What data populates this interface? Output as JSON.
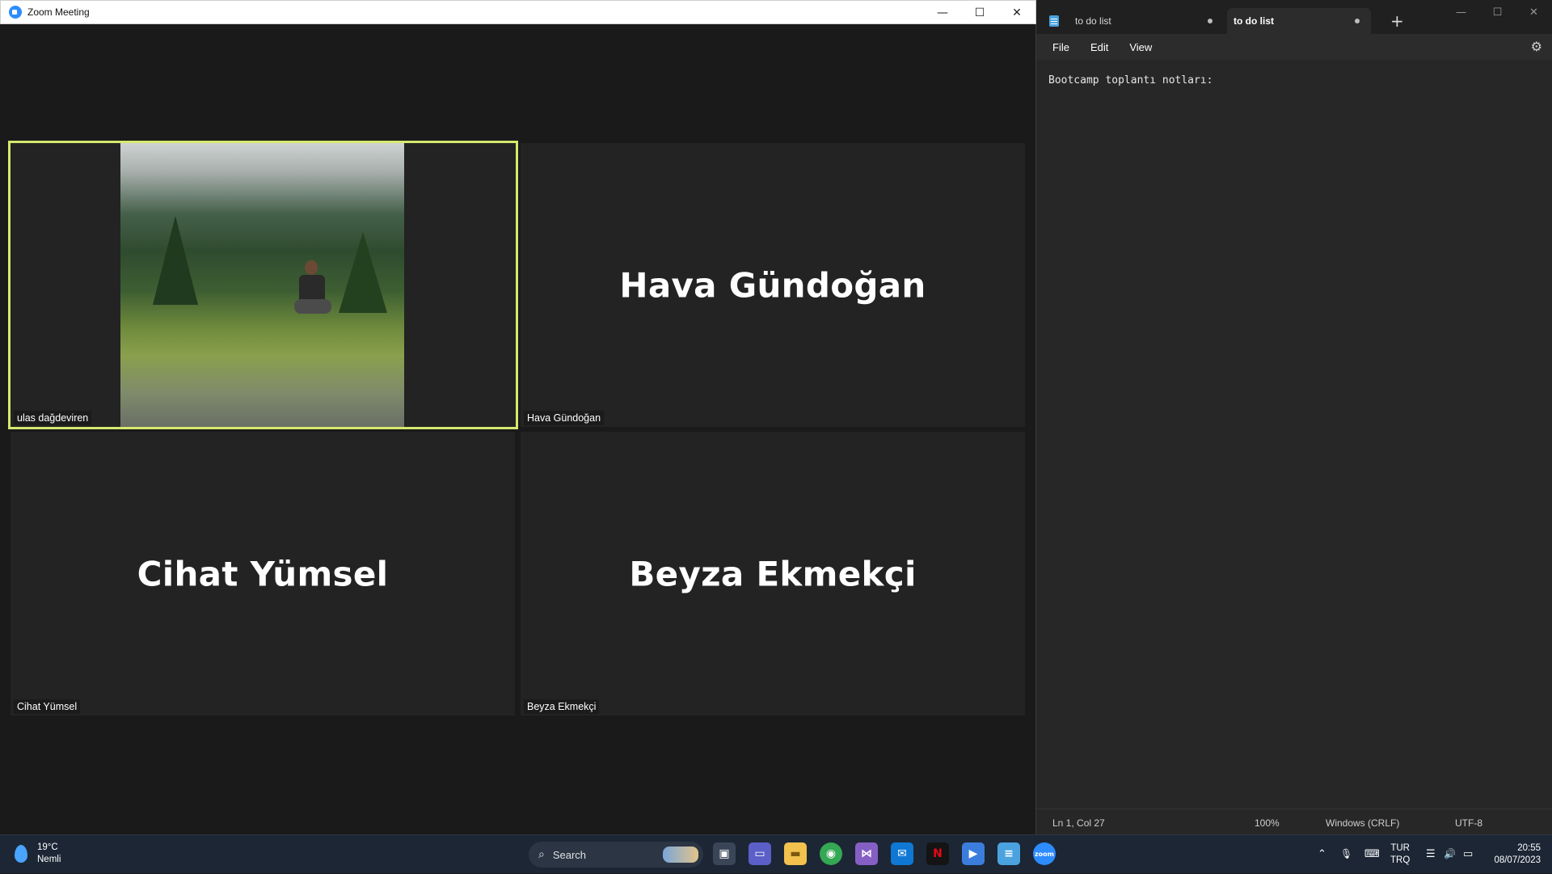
{
  "zoom": {
    "title": "Zoom Meeting",
    "controls": {
      "minimize": "—",
      "maximize": "☐",
      "close": "✕"
    },
    "participants": [
      {
        "display_name": "",
        "name_tag": "ulas dağdeviren",
        "active_speaker": true
      },
      {
        "display_name": "Hava Gündoğan",
        "name_tag": "Hava Gündoğan"
      },
      {
        "display_name": "Cihat Yümsel",
        "name_tag": "Cihat Yümsel"
      },
      {
        "display_name": "Beyza Ekmekçi",
        "name_tag": "Beyza Ekmekçi"
      }
    ]
  },
  "notepad": {
    "tabs": [
      {
        "label": "to do list",
        "active": false
      },
      {
        "label": "to do list",
        "active": true
      }
    ],
    "new_tab": "+",
    "controls": {
      "minimize": "—",
      "maximize": "☐",
      "close": "✕"
    },
    "menu": [
      "File",
      "Edit",
      "View"
    ],
    "settings_icon": "⚙",
    "content": "Bootcamp toplantı notları:",
    "status": {
      "position": "Ln 1, Col 27",
      "zoom": "100%",
      "line_ending": "Windows (CRLF)",
      "encoding": "UTF-8"
    }
  },
  "taskbar": {
    "weather": {
      "temp": "19°C",
      "condition": "Nemli"
    },
    "search": {
      "label": "Search",
      "icon": "⌕"
    },
    "apps": [
      {
        "name": "task-view",
        "glyph": "▣",
        "color": "#3a4658"
      },
      {
        "name": "teams-chat",
        "glyph": "▭",
        "color": "#5b5fc7"
      },
      {
        "name": "file-explorer",
        "glyph": "▬",
        "color": "#f2c14e"
      },
      {
        "name": "chrome",
        "glyph": "◉",
        "color": "#34a853"
      },
      {
        "name": "visual-studio",
        "glyph": "⋈",
        "color": "#865fc5"
      },
      {
        "name": "mail",
        "glyph": "✉",
        "color": "#0f78d4"
      },
      {
        "name": "netflix",
        "glyph": "N",
        "color": "#e50914"
      },
      {
        "name": "power-automate",
        "glyph": "▶",
        "color": "#3b7ddd"
      },
      {
        "name": "notepad",
        "glyph": "≡",
        "color": "#4aa3df"
      },
      {
        "name": "zoom",
        "glyph": "zoom",
        "color": "#2d8cff"
      }
    ],
    "tray": {
      "chevron": "⌃",
      "mic": "🎙",
      "keyboard": "⌨",
      "wifi": "☰",
      "volume": "🔊",
      "battery": "▭"
    },
    "language": {
      "line1": "TUR",
      "line2": "TRQ"
    },
    "clock": {
      "time": "20:55",
      "date": "08/07/2023"
    }
  }
}
